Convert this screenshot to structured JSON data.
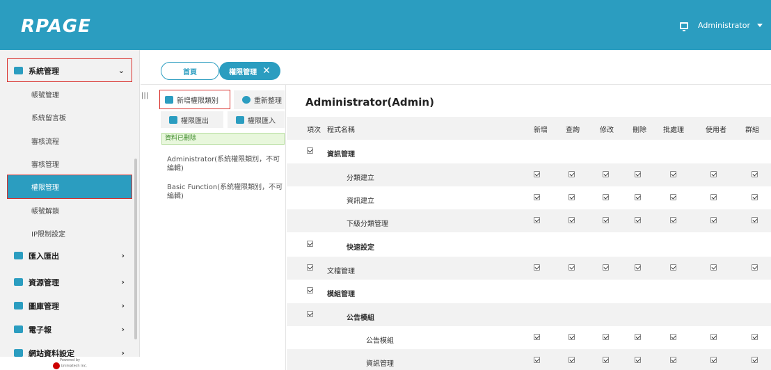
{
  "app": {
    "logo": "RPAGE",
    "user": "Administrator"
  },
  "sidebar": {
    "sections": [
      {
        "label": "系統管理",
        "arrow": "⌄",
        "icon": "sitemap-icon",
        "color": "#2b9dc0"
      },
      {
        "label": "匯入匯出",
        "arrow": "›",
        "icon": "import-export-icon",
        "color": "#2b9dc0"
      },
      {
        "label": "資源管理",
        "arrow": "›",
        "icon": "resource-icon",
        "color": "#2b9dc0"
      },
      {
        "label": "圖庫管理",
        "arrow": "›",
        "icon": "gallery-icon",
        "color": "#2b9dc0"
      },
      {
        "label": "電子報",
        "arrow": "›",
        "icon": "newsletter-icon",
        "color": "#2b9dc0"
      },
      {
        "label": "網站資料設定",
        "arrow": "›",
        "icon": "site-settings-icon",
        "color": "#2b9dc0"
      }
    ],
    "sub_items": [
      "帳號管理",
      "系統留言板",
      "審核流程",
      "審核管理",
      "權限管理",
      "帳號解鎖",
      "IP限制設定"
    ],
    "powered": "Powered by",
    "powered_company": "Unimatech Inc."
  },
  "tabs": {
    "home": "首頁",
    "current": "權限管理",
    "close": "✕"
  },
  "toolbar": {
    "add_label": "新增權限類別",
    "refresh_label": "重新整理",
    "export_label": "權限匯出",
    "import_label": "權限匯入"
  },
  "message": "資料已刪除",
  "roles": [
    "Administrator(系統權限類別，不可編輯)",
    "Basic Function(系統權限類別，不可編輯)"
  ],
  "main": {
    "title": "Administrator(Admin)",
    "headers": [
      "項次",
      "程式名稱",
      "新增",
      "查詢",
      "修改",
      "刪除",
      "批處理",
      "使用者",
      "群組"
    ],
    "rows": [
      {
        "name": "資訊管理",
        "bold": true,
        "indent": 0,
        "perms": false
      },
      {
        "name": "分類建立",
        "bold": false,
        "indent": 1,
        "perms": true
      },
      {
        "name": "資訊建立",
        "bold": false,
        "indent": 1,
        "perms": true
      },
      {
        "name": "下級分類管理",
        "bold": false,
        "indent": 1,
        "perms": true
      },
      {
        "name": "快速設定",
        "bold": true,
        "indent": 1,
        "perms": false
      },
      {
        "name": "文檔管理",
        "bold": false,
        "indent": 0,
        "perms": true
      },
      {
        "name": "模組管理",
        "bold": true,
        "indent": 0,
        "perms": false
      },
      {
        "name": "公告模組",
        "bold": true,
        "indent": 1,
        "perms": false
      },
      {
        "name": "公告模組",
        "bold": false,
        "indent": 2,
        "perms": true
      },
      {
        "name": "資訊管理",
        "bold": false,
        "indent": 2,
        "perms": true
      }
    ]
  },
  "colors": {
    "accent": "#2b9dc0",
    "highlight_border": "#d9302c"
  }
}
